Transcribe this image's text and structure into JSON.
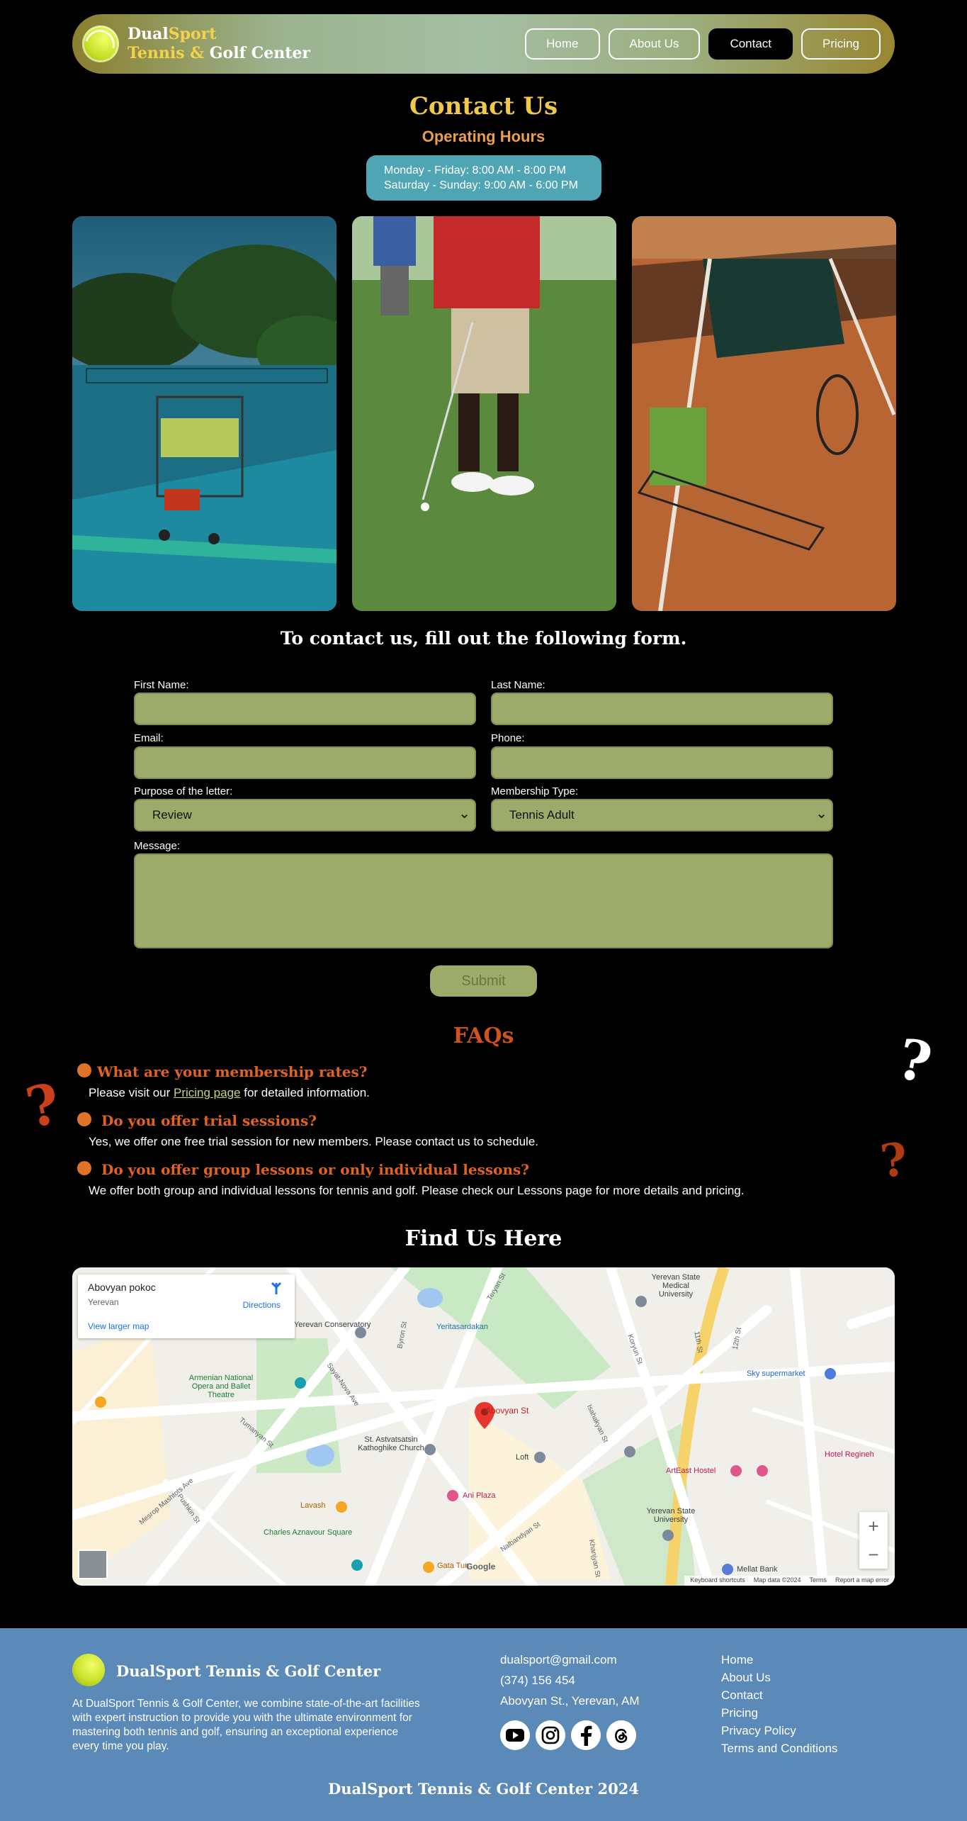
{
  "nav": {
    "brand_line1_a": "Dual",
    "brand_line1_b": "Sport",
    "brand_line2_a": "Tennis & ",
    "brand_line2_b": "Golf Center",
    "items": [
      {
        "label": "Home"
      },
      {
        "label": "About Us"
      },
      {
        "label": "Contact"
      },
      {
        "label": "Pricing"
      }
    ]
  },
  "contact": {
    "title": "Contact Us",
    "hours_title": "Operating Hours",
    "weekday_hours": "Monday - Friday: 8:00 AM - 8:00 PM",
    "weekend_hours": "Saturday - Sunday: 9:00 AM - 6:00 PM"
  },
  "photos": [
    "tennis-ball-cart",
    "golf-putting",
    "tennis-shirt-racket"
  ],
  "form": {
    "title": "To contact us, fill out the following form.",
    "first_name_label": "First Name:",
    "last_name_label": "Last Name:",
    "email_label": "Email:",
    "phone_label": "Phone:",
    "purpose_label": "Purpose of the letter:",
    "purpose_value": "Review",
    "membership_label": "Membership Type:",
    "membership_value": "Tennis Adult",
    "message_label": "Message:",
    "submit_label": "Submit"
  },
  "faq": {
    "title": "FAQs",
    "items": [
      {
        "q": "What are your membership rates?",
        "a_pre": "Please visit our ",
        "a_link": "Pricing page",
        "a_post": " for detailed information."
      },
      {
        "q": "Do you offer trial sessions?",
        "a": "Yes, we offer one free trial session for new members. Please contact us to schedule."
      },
      {
        "q": "Do you offer group lessons or only individual lessons?",
        "a": "We offer both group and individual lessons for tennis and golf. Please check our Lessons page for more details and pricing."
      }
    ]
  },
  "map": {
    "title": "Find Us Here",
    "place_name": "Abovyan pokoc",
    "place_city": "Yerevan",
    "directions": "Directions",
    "larger_map": "View larger map",
    "labels": {
      "medical_univ": "Yerevan State Medical University",
      "conservatory": "Yerevan Conservatory",
      "yeritasardakan": "Yeritasardakan",
      "armenian_opera": "Armenian National Opera and Ballet Theatre",
      "abovyan": "Abovyan St",
      "astvatsatsin": "St. Astvatsatsin Kathoghike Church",
      "loft": "Loft",
      "ani_plaza": "Ani Plaza",
      "artEast": "ArtEast Hostel",
      "sky": "Sky supermarket",
      "hotel": "Hotel Regineh",
      "lavash": "Lavash",
      "aznavour": "Charles Aznavour Square",
      "ysu": "Yerevan State University",
      "mellat": "Mellat Bank",
      "gata": "Gata Tun",
      "teryan": "Teryan St",
      "byron": "Byron St",
      "koryun": "Koryun St",
      "st11": "11th St",
      "st12": "12th St",
      "nalbandyan": "Nalbandyan St",
      "mesrop": "Mesrop Mashtots Ave",
      "pushkin": "Pushkin St",
      "tumanyan": "Tumanyan St",
      "sayat": "Sayat-Nova Ave",
      "isahakyan": "Isahakyan St",
      "khanjyan": "Khanjyan St",
      "google": "Google",
      "keyboard": "Keyboard shortcuts",
      "mapdata": "Map data ©2024",
      "terms": "Terms",
      "report": "Report a map error"
    }
  },
  "footer": {
    "name": "DualSport Tennis & Golf Center",
    "description": "At DualSport Tennis & Golf Center, we combine state-of-the-art facilities with expert instruction to provide you with the ultimate environment for mastering both tennis and golf, ensuring an exceptional experience every time you play.",
    "email": "dualsport@gmail.com",
    "phone": "(374) 156 454",
    "address": "Abovyan St., Yerevan, AM",
    "social": [
      "youtube-icon",
      "instagram-icon",
      "facebook-icon",
      "threads-icon"
    ],
    "links": [
      "Home",
      "About Us",
      "Contact",
      "Pricing",
      "Privacy Policy",
      "Terms and Conditions"
    ],
    "copyright": "DualSport Tennis & Golf Center 2024"
  },
  "colors": {
    "accent_gold": "#f0c84c",
    "accent_orange": "#e2621f",
    "field_green": "#9caa6a",
    "footer_blue": "#5b89b8",
    "hours_teal": "#4fa5b3"
  }
}
